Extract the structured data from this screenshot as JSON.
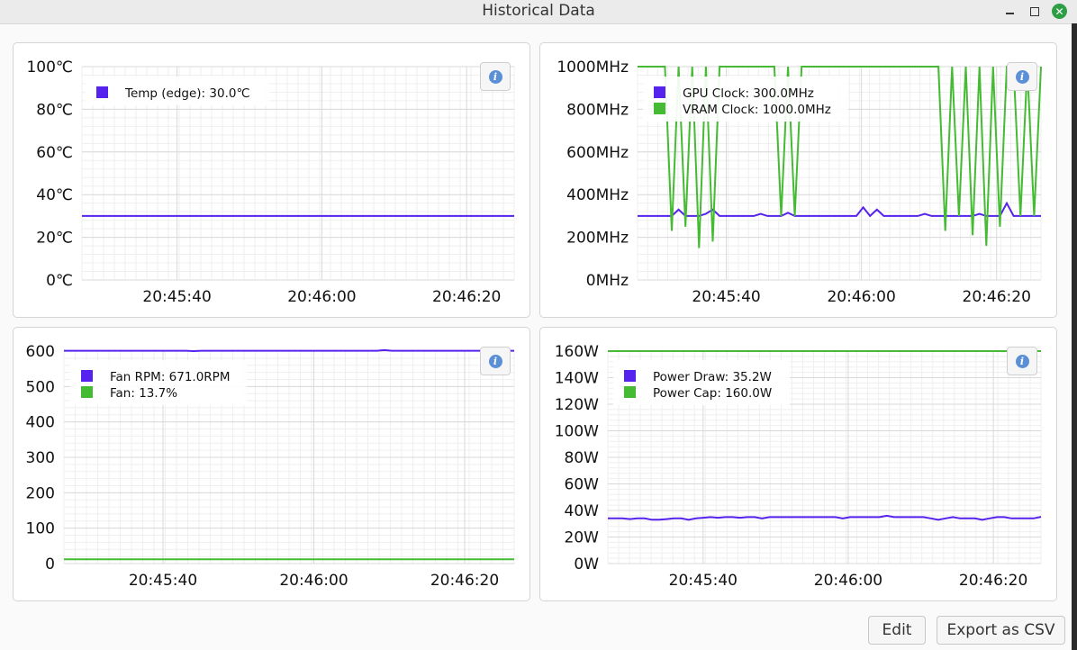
{
  "window": {
    "title": "Historical Data",
    "close_glyph": "✕"
  },
  "buttons": {
    "edit": "Edit",
    "export": "Export as CSV"
  },
  "colors": {
    "series_blue": "#5522ee",
    "series_green": "#44bb33",
    "info_icon": "#5b8fd6",
    "close_button": "#2e9e44"
  },
  "info_icon": "i",
  "chart_data": [
    {
      "type": "line",
      "x_ticks": [
        "20:45:40",
        "20:46:00",
        "20:46:20"
      ],
      "y_ticks": [
        "100℃",
        "80℃",
        "60℃",
        "40℃",
        "20℃",
        "0℃"
      ],
      "ylim": [
        0,
        100
      ],
      "series": [
        {
          "name": "Temp (edge): 30.0℃",
          "color": "#5522ee",
          "values": [
            30,
            30,
            30,
            30,
            30,
            30,
            30,
            30,
            30,
            30,
            30,
            30,
            30,
            30,
            30,
            30,
            30,
            30,
            30,
            30,
            30,
            30,
            30,
            30,
            30,
            30,
            30,
            30,
            30,
            30,
            30,
            30,
            30,
            30,
            30,
            30,
            30,
            30,
            30,
            30,
            30,
            30,
            30,
            30,
            30,
            30,
            30,
            30,
            30,
            30,
            30,
            30,
            30,
            30,
            30,
            30,
            30,
            30,
            30,
            30
          ]
        }
      ]
    },
    {
      "type": "line",
      "x_ticks": [
        "20:45:40",
        "20:46:00",
        "20:46:20"
      ],
      "y_ticks": [
        "1000MHz",
        "800MHz",
        "600MHz",
        "400MHz",
        "200MHz",
        "0MHz"
      ],
      "ylim": [
        0,
        1000
      ],
      "series": [
        {
          "name": "GPU Clock: 300.0MHz",
          "color": "#5522ee",
          "values": [
            300,
            300,
            300,
            300,
            300,
            300,
            330,
            300,
            300,
            300,
            310,
            330,
            300,
            300,
            300,
            300,
            300,
            300,
            310,
            300,
            300,
            300,
            315,
            300,
            300,
            300,
            300,
            300,
            300,
            300,
            300,
            300,
            300,
            340,
            300,
            330,
            300,
            300,
            300,
            300,
            300,
            300,
            310,
            300,
            300,
            300,
            300,
            300,
            300,
            300,
            310,
            300,
            300,
            300,
            360,
            300,
            300,
            300,
            300,
            300
          ]
        },
        {
          "name": "VRAM Clock: 1000.0MHz",
          "color": "#44bb33",
          "values": [
            1000,
            1000,
            1000,
            1000,
            1000,
            230,
            1000,
            250,
            1000,
            150,
            1000,
            180,
            1000,
            1000,
            1000,
            1000,
            1000,
            1000,
            1000,
            1000,
            1000,
            300,
            1000,
            300,
            1000,
            1000,
            1000,
            1000,
            1000,
            1000,
            1000,
            1000,
            1000,
            1000,
            1000,
            1000,
            1000,
            1000,
            1000,
            1000,
            1000,
            1000,
            1000,
            1000,
            1000,
            230,
            1000,
            300,
            1000,
            210,
            1000,
            160,
            1000,
            250,
            1000,
            1000,
            300,
            1000,
            300,
            1000
          ]
        }
      ]
    },
    {
      "type": "line",
      "x_ticks": [
        "20:45:40",
        "20:46:00",
        "20:46:20"
      ],
      "y_ticks": [
        "600",
        "500",
        "400",
        "300",
        "200",
        "100",
        "0"
      ],
      "ylim": [
        0,
        670
      ],
      "series": [
        {
          "name": "Fan RPM: 671.0RPM",
          "color": "#5522ee",
          "values": [
            671,
            671,
            671,
            671,
            671,
            671,
            671,
            671,
            671,
            671,
            671,
            671,
            671,
            671,
            671,
            671,
            671,
            670,
            671,
            671,
            671,
            671,
            671,
            671,
            671,
            671,
            671,
            671,
            671,
            671,
            671,
            671,
            671,
            671,
            671,
            671,
            671,
            671,
            671,
            671,
            671,
            671,
            673,
            671,
            671,
            671,
            671,
            671,
            671,
            671,
            671,
            671,
            671,
            671,
            671,
            671,
            671,
            671,
            671,
            671
          ]
        },
        {
          "name": "Fan: 13.7%",
          "color": "#44bb33",
          "values": [
            13.7,
            13.7,
            13.7,
            13.7,
            13.7,
            13.7,
            13.7,
            13.7,
            13.7,
            13.7,
            13.7,
            13.7,
            13.7,
            13.7,
            13.7,
            13.7,
            13.7,
            13.7,
            13.7,
            13.7,
            13.7,
            13.7,
            13.7,
            13.7,
            13.7,
            13.7,
            13.7,
            13.7,
            13.7,
            13.7,
            13.7,
            13.7,
            13.7,
            13.7,
            13.7,
            13.7,
            13.7,
            13.7,
            13.7,
            13.7,
            13.7,
            13.7,
            13.7,
            13.7,
            13.7,
            13.7,
            13.7,
            13.7,
            13.7,
            13.7,
            13.7,
            13.7,
            13.7,
            13.7,
            13.7,
            13.7,
            13.7,
            13.7,
            13.7,
            13.7
          ]
        }
      ]
    },
    {
      "type": "line",
      "x_ticks": [
        "20:45:40",
        "20:46:00",
        "20:46:20"
      ],
      "y_ticks": [
        "160W",
        "140W",
        "120W",
        "100W",
        "80W",
        "60W",
        "40W",
        "20W",
        "0W"
      ],
      "ylim": [
        0,
        160
      ],
      "series": [
        {
          "name": "Power Draw: 35.2W",
          "color": "#5522ee",
          "values": [
            34,
            34,
            34,
            33.5,
            34,
            34,
            33,
            33,
            33.5,
            34,
            34,
            33,
            34,
            34.5,
            35,
            34.5,
            35,
            35,
            34.5,
            35,
            35,
            34,
            35,
            35,
            35,
            35,
            35,
            35,
            35,
            35,
            35,
            35,
            34,
            35,
            35,
            35,
            35,
            35,
            36,
            35,
            35,
            35,
            35,
            35,
            34,
            33,
            34,
            35,
            34,
            34,
            34,
            33,
            34,
            35,
            35,
            34,
            34,
            34,
            34,
            35.2
          ]
        },
        {
          "name": "Power Cap: 160.0W",
          "color": "#44bb33",
          "values": [
            160,
            160,
            160,
            160,
            160,
            160,
            160,
            160,
            160,
            160,
            160,
            160,
            160,
            160,
            160,
            160,
            160,
            160,
            160,
            160,
            160,
            160,
            160,
            160,
            160,
            160,
            160,
            160,
            160,
            160,
            160,
            160,
            160,
            160,
            160,
            160,
            160,
            160,
            160,
            160,
            160,
            160,
            160,
            160,
            160,
            160,
            160,
            160,
            160,
            160,
            160,
            160,
            160,
            160,
            160,
            160,
            160,
            160,
            160,
            160
          ]
        }
      ]
    }
  ]
}
